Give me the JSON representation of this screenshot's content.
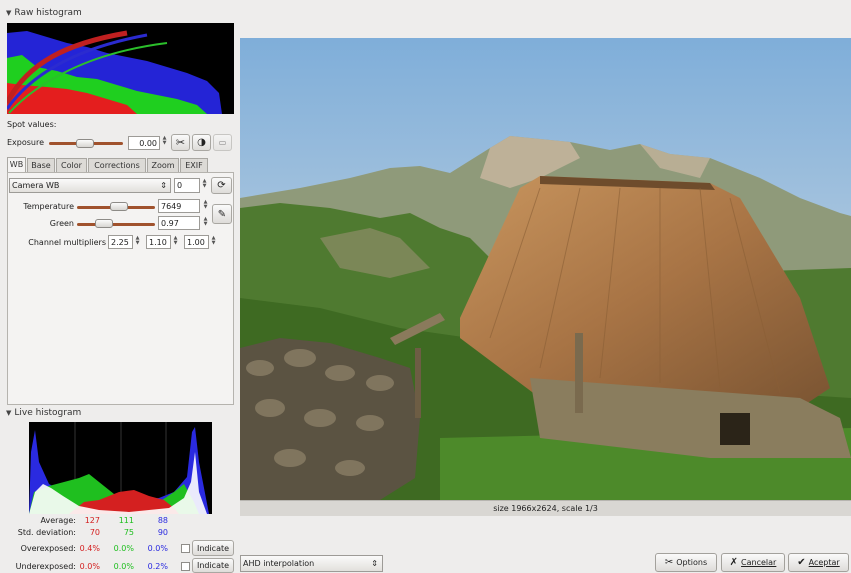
{
  "raw_histogram": {
    "title": "Raw histogram"
  },
  "spot_values": {
    "label": "Spot values:"
  },
  "exposure": {
    "label": "Exposure",
    "value": "0.00",
    "level": 0.5
  },
  "tabs": [
    {
      "label": "WB"
    },
    {
      "label": "Base"
    },
    {
      "label": "Color"
    },
    {
      "label": "Corrections"
    },
    {
      "label": "Zoom"
    },
    {
      "label": "EXIF"
    }
  ],
  "wb": {
    "preset": "Camera WB",
    "preset_value": "0",
    "temperature_label": "Temperature",
    "temperature_value": "7649",
    "green_label": "Green",
    "green_value": "0.97",
    "multipliers_label": "Channel multipliers",
    "multipliers": [
      "2.25",
      "1.10",
      "1.00"
    ]
  },
  "live_histogram": {
    "title": "Live histogram",
    "average_label": "Average:",
    "stddev_label": "Std. deviation:",
    "overexposed_label": "Overexposed:",
    "underexposed_label": "Underexposed:",
    "average": [
      "127",
      "111",
      "88"
    ],
    "stddev": [
      "70",
      "75",
      "90"
    ],
    "overexposed": [
      "0.4%",
      "0.0%",
      "0.0%"
    ],
    "underexposed": [
      "0.0%",
      "0.0%",
      "0.2%"
    ],
    "indicate_label": "Indicate",
    "colors": {
      "red": "#d42020",
      "green": "#1fbf1f",
      "blue": "#2a2ae0"
    }
  },
  "image": {
    "status": "size 1966x2624, scale 1/3"
  },
  "interpolation": {
    "selected": "AHD interpolation"
  },
  "buttons": {
    "options": "Options",
    "cancel": "Cancelar",
    "accept": "Aceptar"
  }
}
